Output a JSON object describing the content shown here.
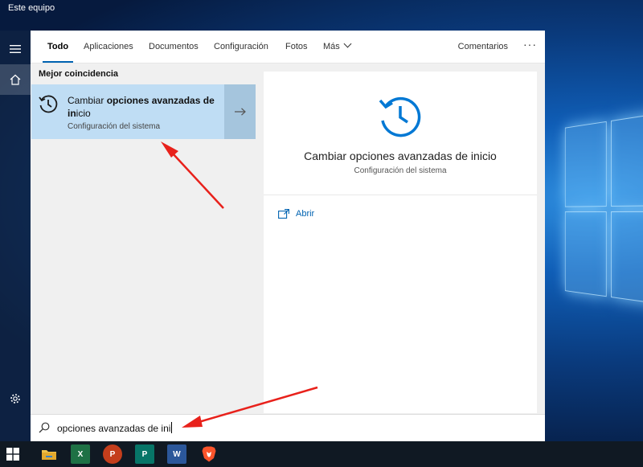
{
  "desktop": {
    "label": "Este equipo"
  },
  "tabs": {
    "items": [
      "Todo",
      "Aplicaciones",
      "Documentos",
      "Configuración",
      "Fotos",
      "Más"
    ],
    "feedback": "Comentarios",
    "more_options": "···"
  },
  "results": {
    "section_label": "Mejor coincidencia",
    "best_match": {
      "title_normal": "Cambiar ",
      "title_bold": "opciones avanzadas de in",
      "title_end": "icio",
      "subtitle": "Configuración del sistema"
    }
  },
  "detail": {
    "title": "Cambiar opciones avanzadas de inicio",
    "subtitle": "Configuración del sistema",
    "action_open": "Abrir"
  },
  "search": {
    "query": "opciones avanzadas de ini"
  },
  "taskbar": {
    "apps": [
      {
        "name": "file-explorer",
        "glyph": ""
      },
      {
        "name": "excel",
        "glyph": "X"
      },
      {
        "name": "powerpoint",
        "glyph": "P"
      },
      {
        "name": "publisher",
        "glyph": "P"
      },
      {
        "name": "word",
        "glyph": "W"
      },
      {
        "name": "brave",
        "glyph": ""
      }
    ]
  },
  "colors": {
    "accent": "#0063b1",
    "selection": "#bfddf4",
    "annotation_arrow": "#e8211b"
  }
}
